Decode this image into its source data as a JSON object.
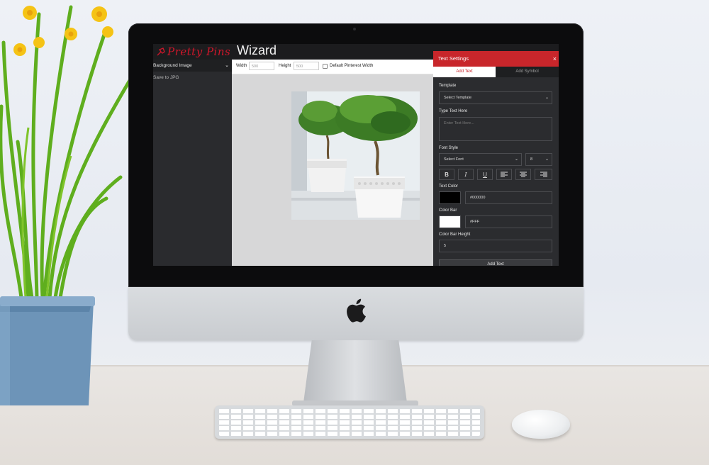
{
  "app": {
    "logo_script": "Pretty Pins",
    "logo_word": "Wizard"
  },
  "sidebar": {
    "items": [
      {
        "label": "Background Image",
        "expanded": true
      },
      {
        "label": "Save to JPG"
      }
    ]
  },
  "toolbar": {
    "width_label": "Width",
    "width_value": "500",
    "height_label": "Height",
    "height_value": "500",
    "default_label": "Default Pinterest Width"
  },
  "panel": {
    "title": "Text Settings",
    "close_glyph": "×",
    "tabs": [
      "Add Text",
      "Add Symbol"
    ],
    "active_tab": "Add Text",
    "template_label": "Template",
    "template_value": "Select Template",
    "text_label": "Type Text Here",
    "text_placeholder": "Enter Text Here...",
    "font_style_label": "Font Style",
    "font_value": "Select Font",
    "font_size_value": "8",
    "format_buttons": [
      "B",
      "I",
      "U",
      "align-left-icon",
      "align-center-icon",
      "align-right-icon"
    ],
    "text_color_label": "Text Color",
    "text_color_value": "#000000",
    "text_color": "#000000",
    "color_bar_label": "Color Bar",
    "color_bar_value": "#FFF",
    "color_bar_color": "#ffffff",
    "bar_height_label": "Color Bar Height",
    "bar_height_value": "5",
    "add_button": "Add Text"
  },
  "colors": {
    "accent": "#c8262b",
    "panel_bg": "#2b2c2f"
  }
}
